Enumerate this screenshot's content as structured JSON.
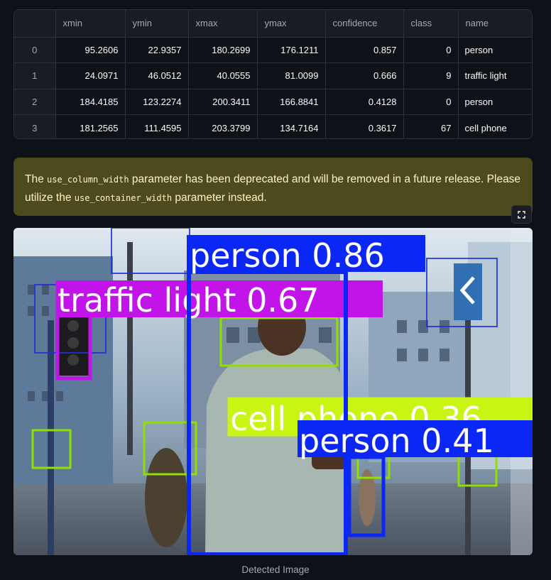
{
  "table": {
    "columns": [
      "",
      "xmin",
      "ymin",
      "xmax",
      "ymax",
      "confidence",
      "class",
      "name"
    ],
    "rows": [
      {
        "idx": "0",
        "xmin": "95.2606",
        "ymin": "22.9357",
        "xmax": "180.2699",
        "ymax": "176.1211",
        "confidence": "0.857",
        "class": "0",
        "name": "person"
      },
      {
        "idx": "1",
        "xmin": "24.0971",
        "ymin": "46.0512",
        "xmax": "40.0555",
        "ymax": "81.0099",
        "confidence": "0.666",
        "class": "9",
        "name": "traffic light"
      },
      {
        "idx": "2",
        "xmin": "184.4185",
        "ymin": "123.2274",
        "xmax": "200.3411",
        "ymax": "166.8841",
        "confidence": "0.4128",
        "class": "0",
        "name": "person"
      },
      {
        "idx": "3",
        "xmin": "181.2565",
        "ymin": "111.4595",
        "xmax": "203.3799",
        "ymax": "134.7164",
        "confidence": "0.3617",
        "class": "67",
        "name": "cell phone"
      }
    ]
  },
  "warning": {
    "prefix": "The ",
    "code1": "use_column_width",
    "middle": " parameter has been deprecated and will be removed in a future release. Please utilize the ",
    "code2": "use_container_width",
    "suffix": " parameter instead."
  },
  "fullscreen_icon": "fullscreen-icon",
  "image": {
    "labels": {
      "person1": "person 0.86",
      "traffic": "traffic light 0.67",
      "cell": "cell phone 0.36",
      "person2": "person 0.41"
    },
    "colors": {
      "person": "#0b27f5",
      "traffic": "#c214e8",
      "cell": "#c8f514",
      "other": "#8ee000"
    }
  },
  "caption": "Detected Image"
}
